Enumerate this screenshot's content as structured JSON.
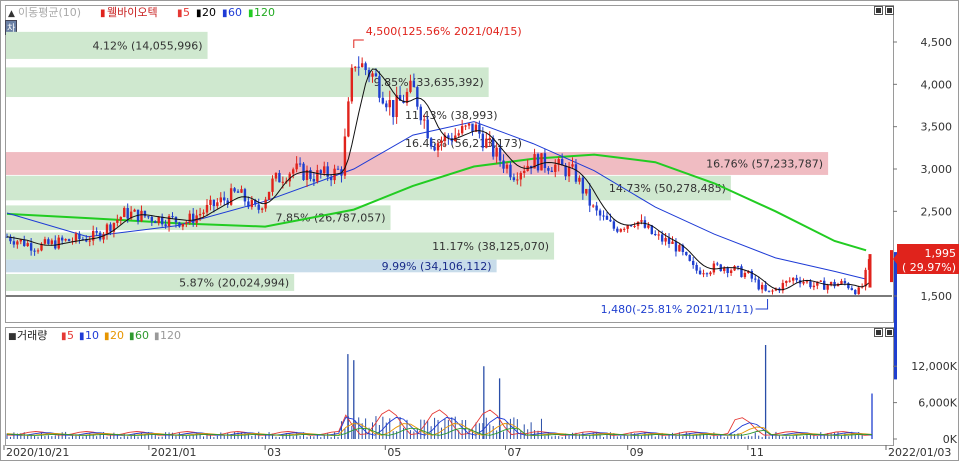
{
  "price_panel": {
    "legend": {
      "prefix": "▲",
      "title": "이동평균(10)",
      "stock": "웰바이오텍",
      "ma": [
        {
          "label": "5",
          "color": "#e53935"
        },
        {
          "label": "20",
          "color": "#000000"
        },
        {
          "label": "60",
          "color": "#1e3bd6"
        },
        {
          "label": "120",
          "color": "#22cc22"
        }
      ]
    },
    "side_tab": "차트",
    "y_ticks": [
      "4,500",
      "4,000",
      "3,500",
      "3,000",
      "2,500",
      "1,500"
    ],
    "current_price": "1,995",
    "current_change": "( 29.97%)",
    "max_label": "4,500(125.56% 2021/04/15)",
    "min_label": "1,480(-25.81% 2021/11/11)"
  },
  "volume_panel": {
    "legend": {
      "prefix": "■",
      "title": "거래량",
      "ma": [
        {
          "label": "5",
          "color": "#e53935"
        },
        {
          "label": "10",
          "color": "#1e3bd6"
        },
        {
          "label": "20",
          "color": "#e69500"
        },
        {
          "label": "60",
          "color": "#2e9a2e"
        },
        {
          "label": "120",
          "color": "#999999"
        }
      ]
    },
    "y_ticks": [
      "12,000K",
      "6,000K",
      "0K"
    ]
  },
  "x_axis": [
    "2020/10/21",
    "2021/01",
    "03",
    "05",
    "07",
    "09",
    "11",
    "2022/01/03"
  ],
  "volume_profile": [
    {
      "pct": "4.12% (14,055,996)",
      "price_lo": 4300,
      "price_hi": 4620,
      "ratio": 0.228,
      "color": "#cfe8cf"
    },
    {
      "pct": "9.85% (33,635,392)",
      "price_lo": 3850,
      "price_hi": 4200,
      "ratio": 0.546,
      "color": "#cfe8cf"
    },
    {
      "pct": "11.43% (38,993)",
      "price_lo": 3450,
      "price_hi": 3820,
      "ratio": 0.0,
      "color": "#cfe8cf"
    },
    {
      "pct": "16.46% (56,213,173)",
      "price_lo": 3200,
      "price_hi": 3420,
      "ratio": 0.0,
      "color": "#cfe8cf"
    },
    {
      "pct": "16.76% (57,233,787)",
      "price_lo": 2930,
      "price_hi": 3200,
      "ratio": 0.93,
      "color": "#f0bcc2"
    },
    {
      "pct": "14.73% (50,278,485)",
      "price_lo": 2630,
      "price_hi": 2920,
      "ratio": 0.82,
      "color": "#cfe8cf"
    },
    {
      "pct": "7.85% (26,787,057)",
      "price_lo": 2280,
      "price_hi": 2570,
      "ratio": 0.435,
      "color": "#cfe8cf"
    },
    {
      "pct": "11.17% (38,125,070)",
      "price_lo": 1930,
      "price_hi": 2250,
      "ratio": 0.62,
      "color": "#cfe8cf"
    },
    {
      "pct": "9.99% (34,106,112)",
      "price_lo": 1780,
      "price_hi": 1930,
      "ratio": 0.555,
      "color": "#c8dcea"
    },
    {
      "pct": "5.87% (20,024,994)",
      "price_lo": 1560,
      "price_hi": 1760,
      "ratio": 0.326,
      "color": "#cfe8cf"
    }
  ],
  "chart_data": {
    "type": "candlestick",
    "title": "웰바이오텍",
    "x_range": [
      "2020/10/21",
      "2022/01/03"
    ],
    "y_range": [
      1480,
      4500
    ],
    "price_close_path": [
      [
        "2020/10/21",
        2200
      ],
      [
        "2020/11/05",
        2080
      ],
      [
        "2020/11/20",
        2150
      ],
      [
        "2020/12/05",
        2200
      ],
      [
        "2020/12/20",
        2480
      ],
      [
        "2021/01/05",
        2420
      ],
      [
        "2021/01/20",
        2380
      ],
      [
        "2021/02/05",
        2600
      ],
      [
        "2021/02/15",
        2720
      ],
      [
        "2021/02/25",
        2500
      ],
      [
        "2021/03/05",
        2850
      ],
      [
        "2021/03/15",
        3000
      ],
      [
        "2021/03/25",
        2920
      ],
      [
        "2021/04/05",
        2950
      ],
      [
        "2021/04/09",
        3000
      ],
      [
        "2021/04/15",
        4300
      ],
      [
        "2021/04/25",
        4100
      ],
      [
        "2021/05/05",
        3700
      ],
      [
        "2021/05/15",
        3950
      ],
      [
        "2021/05/25",
        3300
      ],
      [
        "2021/06/05",
        3400
      ],
      [
        "2021/06/15",
        3500
      ],
      [
        "2021/06/25",
        3200
      ],
      [
        "2021/07/05",
        2950
      ],
      [
        "2021/07/15",
        3100
      ],
      [
        "2021/07/25",
        3050
      ],
      [
        "2021/08/05",
        2950
      ],
      [
        "2021/08/15",
        2500
      ],
      [
        "2021/08/25",
        2300
      ],
      [
        "2021/09/05",
        2400
      ],
      [
        "2021/09/15",
        2200
      ],
      [
        "2021/09/25",
        2100
      ],
      [
        "2021/10/05",
        1800
      ],
      [
        "2021/10/20",
        1850
      ],
      [
        "2021/11/01",
        1750
      ],
      [
        "2021/11/11",
        1520
      ],
      [
        "2021/11/25",
        1720
      ],
      [
        "2021/12/05",
        1620
      ],
      [
        "2021/12/20",
        1650
      ],
      [
        "2021/12/28",
        1540
      ],
      [
        "2022/01/03",
        1995
      ]
    ],
    "ma120_path": [
      [
        "2020/10/21",
        2470
      ],
      [
        "2020/12/01",
        2420
      ],
      [
        "2021/01/15",
        2360
      ],
      [
        "2021/03/01",
        2320
      ],
      [
        "2021/04/15",
        2520
      ],
      [
        "2021/05/15",
        2800
      ],
      [
        "2021/06/15",
        3030
      ],
      [
        "2021/07/15",
        3120
      ],
      [
        "2021/08/15",
        3170
      ],
      [
        "2021/09/15",
        3080
      ],
      [
        "2021/10/15",
        2830
      ],
      [
        "2021/11/15",
        2500
      ],
      [
        "2021/12/15",
        2150
      ],
      [
        "2021/12/31",
        2040
      ]
    ],
    "ma60_path": [
      [
        "2020/10/21",
        2480
      ],
      [
        "2020/12/01",
        2200
      ],
      [
        "2021/01/15",
        2330
      ],
      [
        "2021/03/01",
        2620
      ],
      [
        "2021/04/15",
        3000
      ],
      [
        "2021/05/15",
        3400
      ],
      [
        "2021/06/15",
        3560
      ],
      [
        "2021/07/15",
        3300
      ],
      [
        "2021/08/15",
        2980
      ],
      [
        "2021/09/15",
        2550
      ],
      [
        "2021/10/15",
        2230
      ],
      [
        "2021/11/15",
        1950
      ],
      [
        "2021/12/15",
        1790
      ],
      [
        "2021/12/31",
        1700
      ]
    ],
    "volume_spikes": [
      {
        "date": "2021/04/12",
        "value": 14000
      },
      {
        "date": "2021/04/15",
        "value": 13000
      },
      {
        "date": "2021/06/20",
        "value": 12000
      },
      {
        "date": "2021/06/28",
        "value": 10000
      },
      {
        "date": "2021/11/10",
        "value": 15500
      },
      {
        "date": "2022/01/03",
        "value": 7500
      }
    ],
    "volume_range": [
      0,
      15500
    ]
  }
}
